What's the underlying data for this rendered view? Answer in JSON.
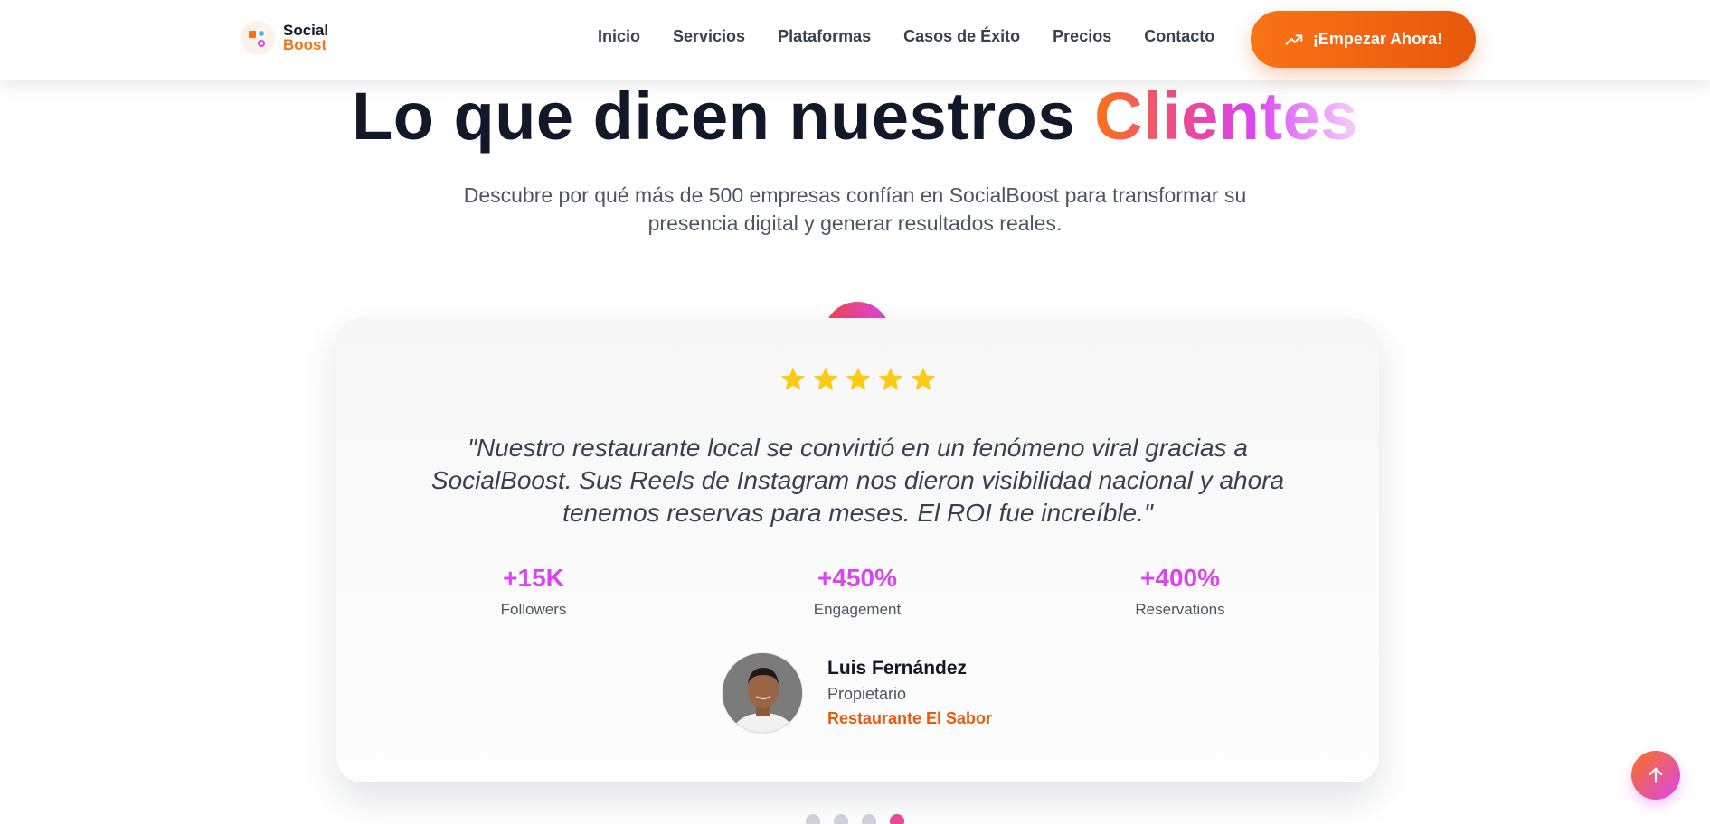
{
  "header": {
    "logo": {
      "line1": "Social",
      "line2": "Boost"
    },
    "nav": [
      "Inicio",
      "Servicios",
      "Plataformas",
      "Casos de Éxito",
      "Precios",
      "Contacto"
    ],
    "cta_label": "¡Empezar Ahora!",
    "cta_icon": "trending-up-icon"
  },
  "hero": {
    "title_main": "Lo que dicen nuestros ",
    "title_highlight": "Clientes",
    "subtitle": "Descubre por qué más de 500 empresas confían en SocialBoost para transformar su presencia digital y generar resultados reales."
  },
  "testimonial": {
    "rating": 5,
    "rating_max": 5,
    "quote": "\"Nuestro restaurante local se convirtió en un fenómeno viral gracias a SocialBoost. Sus Reels de Instagram nos dieron visibilidad nacional y ahora tenemos reservas para meses. El ROI fue increíble.\"",
    "stats": [
      {
        "value": "+15K",
        "label": "Followers"
      },
      {
        "value": "+450%",
        "label": "Engagement"
      },
      {
        "value": "+400%",
        "label": "Reservations"
      }
    ],
    "author": {
      "name": "Luis Fernández",
      "role": "Propietario",
      "company": "Restaurante El Sabor"
    }
  },
  "carousel": {
    "count": 4,
    "active_index": 3
  },
  "colors": {
    "accent_orange": "#f97316",
    "accent_magenta": "#d946ef",
    "text_dark": "#111827",
    "text_muted": "#4b5563",
    "star": "#facc15"
  },
  "scroll_top_icon": "arrow-up-icon"
}
